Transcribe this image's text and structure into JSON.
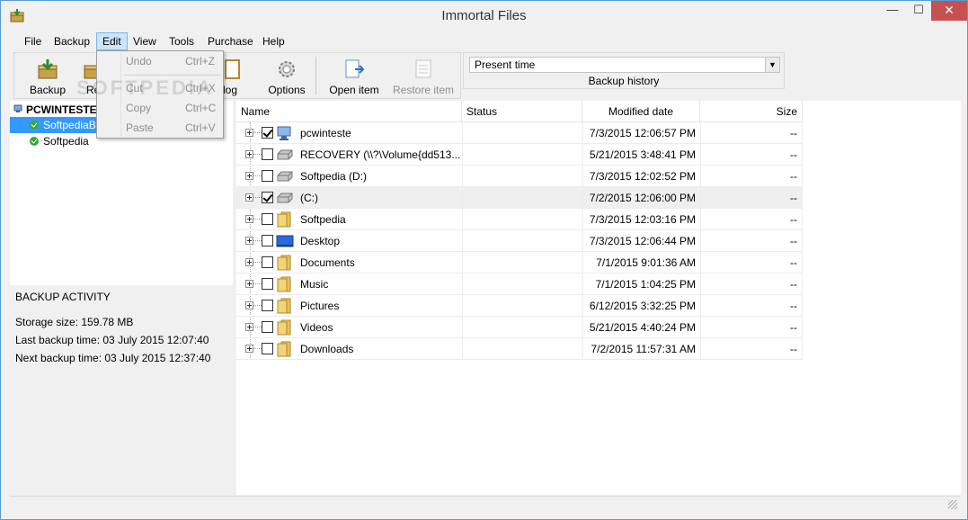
{
  "window": {
    "title": "Immortal Files",
    "close_glyph": "✕",
    "minimize_glyph": "—",
    "maximize_glyph": "☐"
  },
  "menu": [
    "File",
    "Backup",
    "Edit",
    "View",
    "Tools",
    "Purchase",
    "Help"
  ],
  "toolbar": {
    "backup": "Backup",
    "restore_partial": "Re",
    "view_log_partial": "w log",
    "options": "Options",
    "open_item": "Open item",
    "restore_item": "Restore item"
  },
  "history": {
    "selected": "Present time",
    "label": "Backup history"
  },
  "edit_menu": {
    "undo": "Undo",
    "undo_key": "Ctrl+Z",
    "cut": "Cut",
    "cut_key": "Ctrl+X",
    "copy": "Copy",
    "copy_key": "Ctrl+C",
    "paste": "Paste",
    "paste_key": "Ctrl+V"
  },
  "tree": {
    "root": "PCWINTESTE",
    "items": [
      "SoftpediaBa",
      "Softpedia"
    ]
  },
  "activity": {
    "title": "BACKUP ACTIVITY",
    "storage": "Storage size: 159.78 MB",
    "last": "Last backup time: 03 July 2015 12:07:40",
    "next": "Next backup time: 03 July 2015 12:37:40"
  },
  "columns": {
    "name": "Name",
    "status": "Status",
    "modified": "Modified date",
    "size": "Size"
  },
  "rows": [
    {
      "name": "pcwinteste",
      "status": "",
      "date": "7/3/2015 12:06:57 PM",
      "size": "--",
      "checked": true
    },
    {
      "name": "RECOVERY (\\\\?\\Volume{dd513...",
      "status": "",
      "date": "5/21/2015 3:48:41 PM",
      "size": "--",
      "checked": false
    },
    {
      "name": "Softpedia (D:)",
      "status": "",
      "date": "7/3/2015 12:02:52 PM",
      "size": "--",
      "checked": false
    },
    {
      "name": " (C:)",
      "status": "",
      "date": "7/2/2015 12:06:00 PM",
      "size": "--",
      "checked": true
    },
    {
      "name": "Softpedia",
      "status": "",
      "date": "7/3/2015 12:03:16 PM",
      "size": "--",
      "checked": false
    },
    {
      "name": "Desktop",
      "status": "",
      "date": "7/3/2015 12:06:44 PM",
      "size": "--",
      "checked": false
    },
    {
      "name": "Documents",
      "status": "",
      "date": "7/1/2015 9:01:36 AM",
      "size": "--",
      "checked": false
    },
    {
      "name": "Music",
      "status": "",
      "date": "7/1/2015 1:04:25 PM",
      "size": "--",
      "checked": false
    },
    {
      "name": "Pictures",
      "status": "",
      "date": "6/12/2015 3:32:25 PM",
      "size": "--",
      "checked": false
    },
    {
      "name": "Videos",
      "status": "",
      "date": "5/21/2015 4:40:24 PM",
      "size": "--",
      "checked": false
    },
    {
      "name": "Downloads",
      "status": "",
      "date": "7/2/2015 11:57:31 AM",
      "size": "--",
      "checked": false
    }
  ],
  "watermark": "SOFTPEDIA",
  "colors": {
    "accent": "#3399ff",
    "close": "#c75050",
    "ok": "#3aa53a"
  }
}
